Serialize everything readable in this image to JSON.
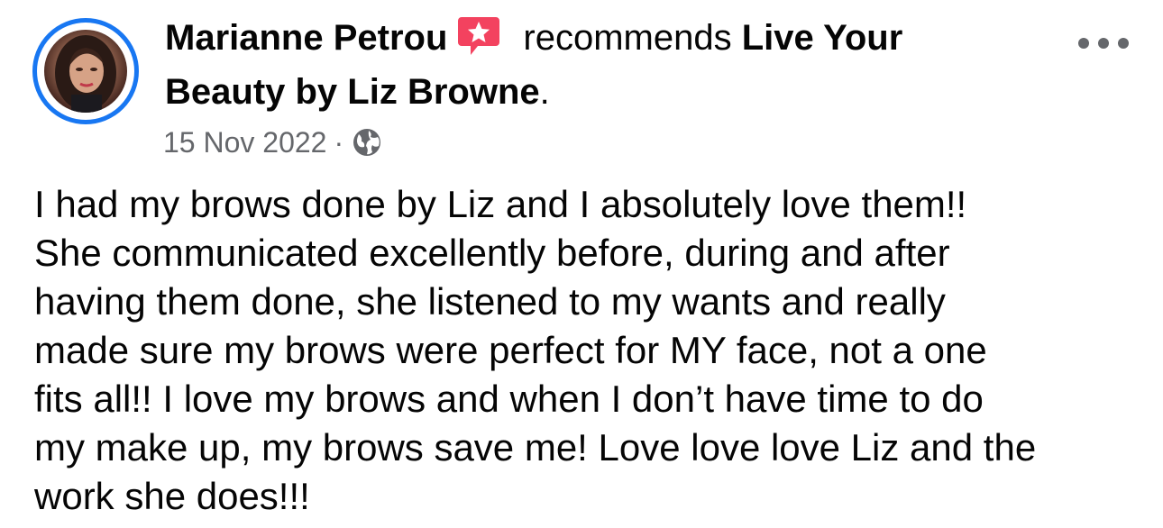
{
  "post": {
    "author_name": "Marianne Petrou",
    "badge_icon": "recommendation-star-icon",
    "action_text": "recommends",
    "page_name_line1": "Live Your",
    "page_name_line2": "Beauty by Liz Browne",
    "page_name_suffix": ".",
    "date": "15 Nov 2022",
    "separator": "·",
    "privacy_icon": "globe-icon",
    "more_icon": "more-options-icon",
    "review_lines": [
      "I had my brows done by Liz and I absolutely love them!!",
      "She communicated excellently before, during and after",
      "having them done, she listened to my wants and really",
      "made sure my brows were perfect for MY face, not a one",
      "fits all!! I love my brows and when I don’t have time to do",
      "my make up, my brows save me! Love love love Liz and the",
      "work she does!!!"
    ]
  },
  "colors": {
    "avatar_ring": "#1877f2",
    "badge": "#f3425f",
    "secondary_text": "#65676b",
    "primary_text": "#050505"
  }
}
